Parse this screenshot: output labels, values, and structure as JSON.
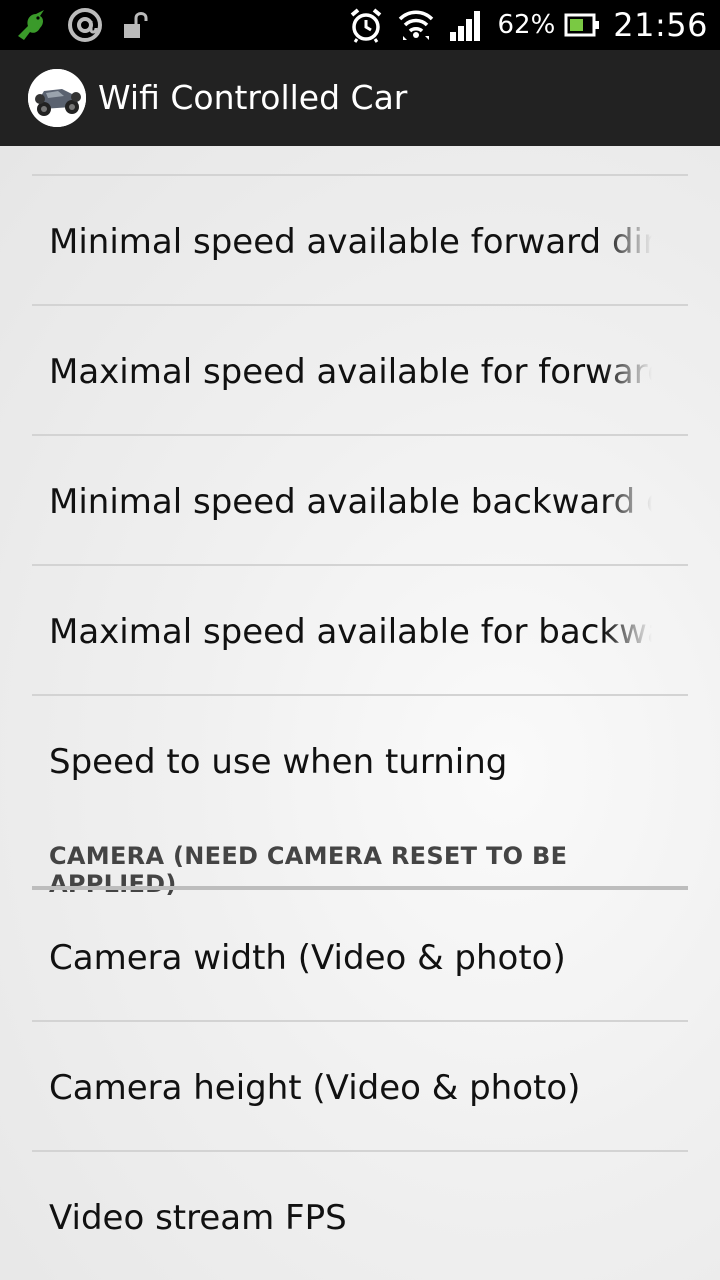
{
  "status_bar": {
    "left_icons": [
      "hummingbird-icon",
      "at-sign-icon",
      "unlock-icon"
    ],
    "right_icons": [
      "alarm-icon",
      "wifi-icon",
      "signal-icon"
    ],
    "battery_percent": "62%",
    "battery_icon": "battery-icon",
    "time": "21:56"
  },
  "action_bar": {
    "app_icon": "rc-car-icon",
    "title": "Wifi Controlled Car"
  },
  "preferences": {
    "items": [
      {
        "title": "Minimal speed available forward direction"
      },
      {
        "title": "Maximal speed available for forward direction"
      },
      {
        "title": "Minimal speed available backward direction"
      },
      {
        "title": "Maximal speed available for backward direction"
      },
      {
        "title": "Speed to use when turning"
      }
    ],
    "category": {
      "title": "CAMERA (NEED CAMERA RESET TO BE APPLIED)"
    },
    "camera_items": [
      {
        "title": "Camera width (Video & photo)"
      },
      {
        "title": "Camera height (Video & photo)"
      },
      {
        "title": "Video stream FPS"
      }
    ]
  },
  "colors": {
    "status_bar_bg": "#000000",
    "action_bar_bg": "#222222",
    "text": "#111111",
    "category_text": "#444444",
    "hummingbird_green": "#3a9a2a"
  }
}
